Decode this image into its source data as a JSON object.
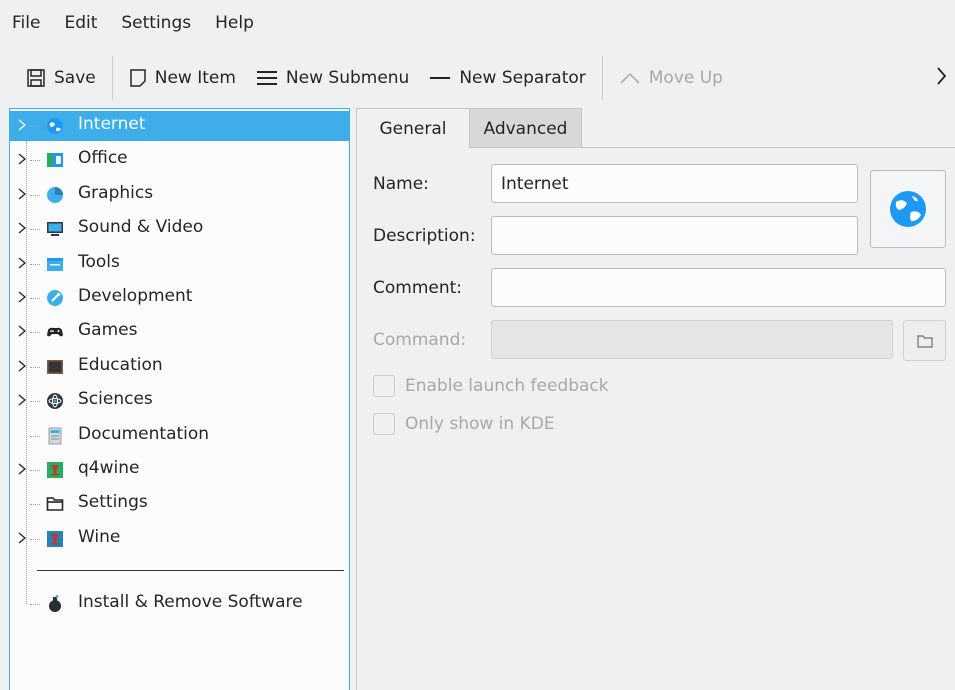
{
  "menubar": {
    "items": [
      "File",
      "Edit",
      "Settings",
      "Help"
    ]
  },
  "toolbar": {
    "save": "Save",
    "new_item": "New Item",
    "new_submenu": "New Submenu",
    "new_separator": "New Separator",
    "move_up": "Move Up",
    "more_icon": "chevron-right-icon"
  },
  "tree": {
    "items": [
      {
        "label": "Internet",
        "icon": "globe-icon",
        "expandable": true,
        "selected": true
      },
      {
        "label": "Office",
        "icon": "office-icon",
        "expandable": true
      },
      {
        "label": "Graphics",
        "icon": "graphics-icon",
        "expandable": true
      },
      {
        "label": "Sound & Video",
        "icon": "monitor-icon",
        "expandable": true
      },
      {
        "label": "Tools",
        "icon": "tools-icon",
        "expandable": true
      },
      {
        "label": "Development",
        "icon": "development-icon",
        "expandable": true
      },
      {
        "label": "Games",
        "icon": "gamepad-icon",
        "expandable": true
      },
      {
        "label": "Education",
        "icon": "chalkboard-icon",
        "expandable": true
      },
      {
        "label": "Sciences",
        "icon": "atom-icon",
        "expandable": true
      },
      {
        "label": "Documentation",
        "icon": "document-icon",
        "expandable": false
      },
      {
        "label": "q4wine",
        "icon": "wine-glass-icon",
        "expandable": true
      },
      {
        "label": "Settings",
        "icon": "folder-icon",
        "expandable": false
      },
      {
        "label": "Wine",
        "icon": "wine-icon",
        "expandable": true
      }
    ],
    "bottom_item": {
      "label": "Install & Remove Software",
      "icon": "flask-icon"
    }
  },
  "tabs": {
    "general": "General",
    "advanced": "Advanced"
  },
  "form": {
    "name_label": "Name:",
    "name_value": "Internet",
    "description_label": "Description:",
    "description_value": "",
    "comment_label": "Comment:",
    "comment_value": "",
    "command_label": "Command:",
    "command_value": "",
    "enable_launch_feedback": "Enable launch feedback",
    "only_show_in_kde": "Only show in KDE"
  },
  "colors": {
    "accent": "#3daee9",
    "window": "#eff0f1",
    "text": "#232627",
    "disabled_text": "#a6a8aa"
  }
}
